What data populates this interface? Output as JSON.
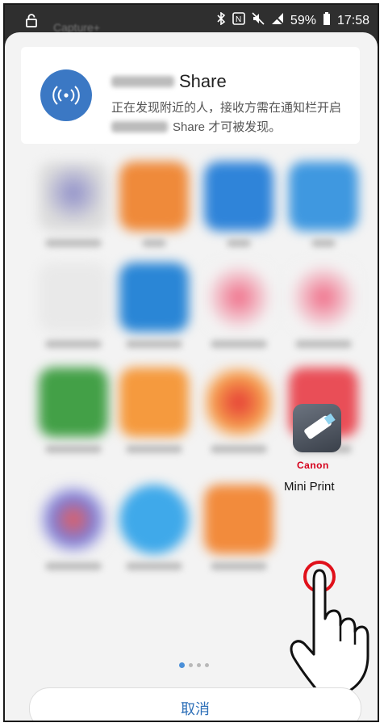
{
  "status_bar": {
    "battery": "59%",
    "time": "17:58",
    "background_ghost_text": "Capture+"
  },
  "share_card": {
    "title": "Share",
    "line1": "正在发现附近的人，接收方需在通知栏开启",
    "line2": "Share 才可被发现。"
  },
  "apps": {
    "selected_brand": "Canon",
    "selected_label": "Mini Print"
  },
  "pager": {
    "pages": 4,
    "active": 0
  },
  "footer": {
    "cancel_label": "取消"
  },
  "colors": {
    "accent": "#3b78c4",
    "highlight_ring": "#e0101a",
    "canon_red": "#d5001c"
  },
  "icons": [
    "lock-icon",
    "bluetooth-icon",
    "nfc-icon",
    "mute-icon",
    "no-signal-icon",
    "battery-icon",
    "share-radar-icon",
    "pointer-hand-icon"
  ]
}
